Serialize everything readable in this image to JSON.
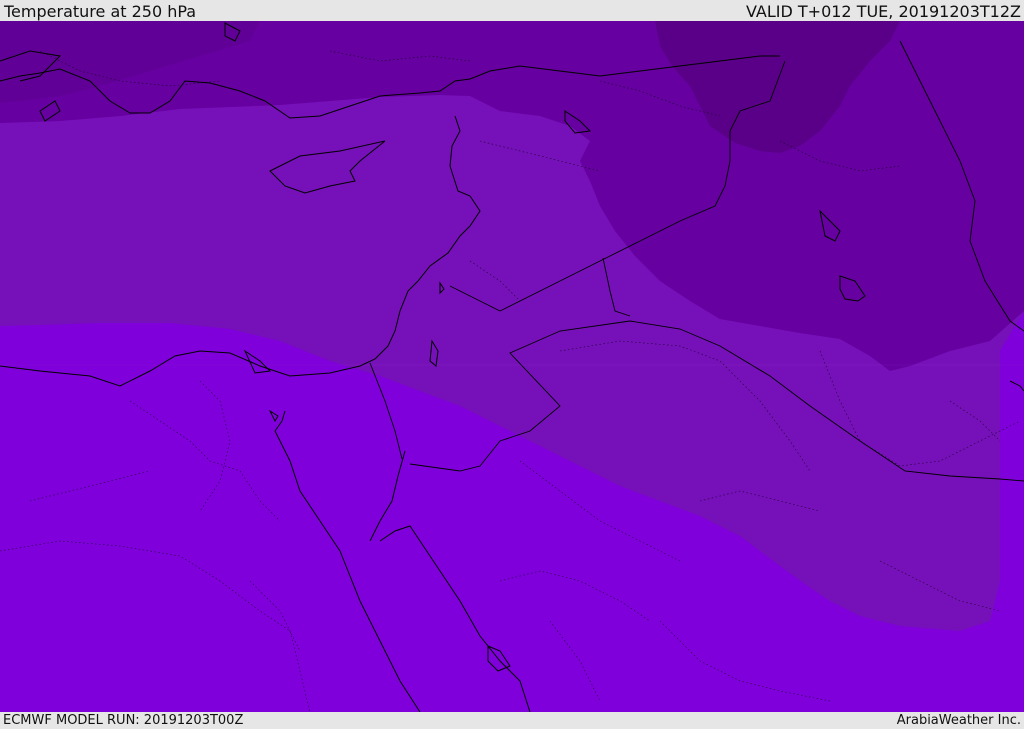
{
  "header": {
    "title": "Temperature at 250 hPa",
    "valid_time": "VALID T+012 TUE, 20191203T12Z"
  },
  "footer": {
    "model_run": "ECMWF MODEL RUN: 20191203T00Z",
    "credit": "ArabiaWeather Inc."
  },
  "map": {
    "field": "temperature-250hPa",
    "color_bands": [
      {
        "name": "darkest",
        "color": "#5a0088"
      },
      {
        "name": "dark",
        "color": "#6600a0"
      },
      {
        "name": "medium",
        "color": "#7610b8"
      },
      {
        "name": "light",
        "color": "#7f00db"
      }
    ],
    "coastline_color": "#000000",
    "border_color": "#000000"
  }
}
